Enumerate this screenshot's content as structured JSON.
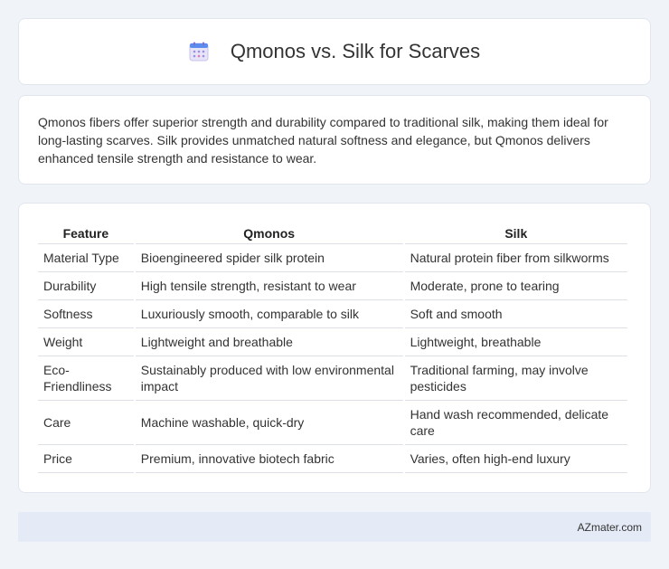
{
  "header": {
    "title": "Qmonos vs. Silk for Scarves",
    "icon": "calendar-icon"
  },
  "summary": {
    "text": "Qmonos fibers offer superior strength and durability compared to traditional silk, making them ideal for long-lasting scarves. Silk provides unmatched natural softness and elegance, but Qmonos delivers enhanced tensile strength and resistance to wear."
  },
  "table": {
    "headers": [
      "Feature",
      "Qmonos",
      "Silk"
    ],
    "rows": [
      [
        "Material Type",
        "Bioengineered spider silk protein",
        "Natural protein fiber from silkworms"
      ],
      [
        "Durability",
        "High tensile strength, resistant to wear",
        "Moderate, prone to tearing"
      ],
      [
        "Softness",
        "Luxuriously smooth, comparable to silk",
        "Soft and smooth"
      ],
      [
        "Weight",
        "Lightweight and breathable",
        "Lightweight, breathable"
      ],
      [
        "Eco-Friendliness",
        "Sustainably produced with low environmental impact",
        "Traditional farming, may involve pesticides"
      ],
      [
        "Care",
        "Machine washable, quick-dry",
        "Hand wash recommended, delicate care"
      ],
      [
        "Price",
        "Premium, innovative biotech fabric",
        "Varies, often high-end luxury"
      ]
    ]
  },
  "footer": {
    "brand": "AZmater.com"
  }
}
